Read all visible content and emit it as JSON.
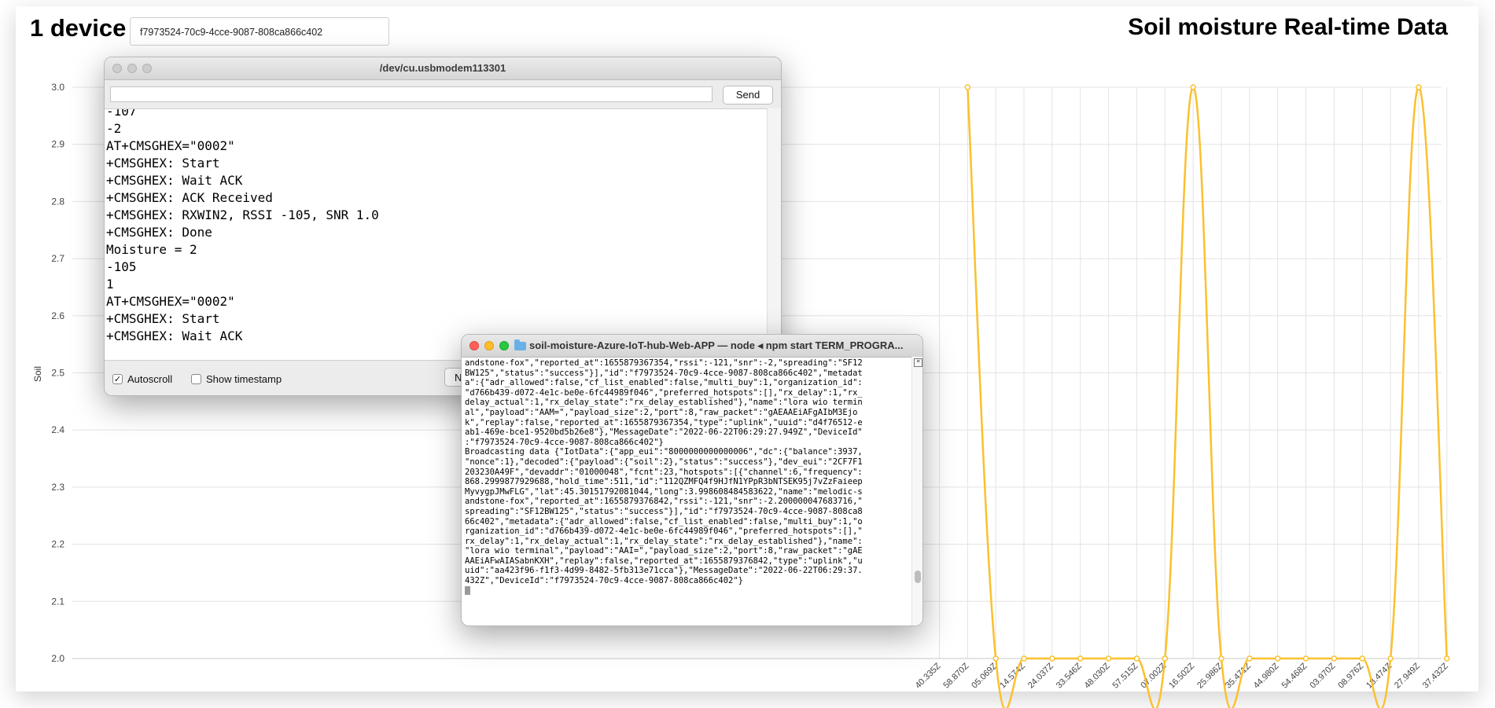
{
  "page": {
    "device_count_label": "1 device",
    "device_select_value": "f7973524-70c9-4cce-9087-808ca866c402",
    "title": "Soil moisture Real-time Data"
  },
  "chart_data": {
    "type": "line",
    "ylabel": "Soil",
    "ylim": [
      2.0,
      3.0
    ],
    "yticks": [
      "3.0",
      "2.9",
      "2.8",
      "2.7",
      "2.6",
      "2.5",
      "2.4",
      "2.3",
      "2.2",
      "2.1",
      "2.0"
    ],
    "grid": true,
    "color": "#fbc02d",
    "x": [
      "40.335Z",
      "58.870Z",
      "05.069Z",
      "14.574Z",
      "24.037Z",
      "33.546Z",
      "48.030Z",
      "57.515Z",
      "07.002Z",
      "16.502Z",
      "25.986Z",
      "35.471Z",
      "44.980Z",
      "54.468Z",
      "03.970Z",
      "08.976Z",
      "18.474Z",
      "27.949Z",
      "37.432Z"
    ],
    "values": [
      null,
      3,
      2,
      2,
      2,
      2,
      2,
      2,
      2,
      3,
      2,
      2,
      2,
      2,
      2,
      2,
      2,
      3,
      2
    ]
  },
  "serial_monitor": {
    "title": "/dev/cu.usbmodem113301",
    "send_label": "Send",
    "send_value": "",
    "lines": [
      "-107",
      "-2",
      "AT+CMSGHEX=\"0002\"",
      "+CMSGHEX: Start",
      "+CMSGHEX: Wait ACK",
      "+CMSGHEX: ACK Received",
      "+CMSGHEX: RXWIN2, RSSI -105, SNR 1.0",
      "+CMSGHEX: Done",
      "Moisture = 2",
      "-105",
      "1",
      "AT+CMSGHEX=\"0002\"",
      "+CMSGHEX: Start",
      "+CMSGHEX: Wait ACK"
    ],
    "autoscroll_label": "Autoscroll",
    "autoscroll_checked": true,
    "timestamp_label": "Show timestamp",
    "timestamp_checked": false,
    "partial_button_label": "Ne"
  },
  "terminal": {
    "title": "soil-moisture-Azure-IoT-hub-Web-APP — node ◂ npm start TERM_PROGRA...",
    "lines": [
      "andstone-fox\",\"reported_at\":1655879367354,\"rssi\":-121,\"snr\":-2,\"spreading\":\"SF12",
      "BW125\",\"status\":\"success\"}],\"id\":\"f7973524-70c9-4cce-9087-808ca866c402\",\"metadat",
      "a\":{\"adr_allowed\":false,\"cf_list_enabled\":false,\"multi_buy\":1,\"organization_id\":",
      "\"d766b439-d072-4e1c-be0e-6fc44989f046\",\"preferred_hotspots\":[],\"rx_delay\":1,\"rx_",
      "delay_actual\":1,\"rx_delay_state\":\"rx_delay_established\"},\"name\":\"lora wio termin",
      "al\",\"payload\":\"AAM=\",\"payload_size\":2,\"port\":8,\"raw_packet\":\"gAEAAEiAFgAIbM3Ejo",
      "k\",\"replay\":false,\"reported_at\":1655879367354,\"type\":\"uplink\",\"uuid\":\"d4f76512-e",
      "ab1-469e-bce1-9520bd5b26e8\"},\"MessageDate\":\"2022-06-22T06:29:27.949Z\",\"DeviceId\"",
      ":\"f7973524-70c9-4cce-9087-808ca866c402\"}",
      "Broadcasting data {\"IotData\":{\"app_eui\":\"8000000000000006\",\"dc\":{\"balance\":3937,",
      "\"nonce\":1},\"decoded\":{\"payload\":{\"soil\":2},\"status\":\"success\"},\"dev_eui\":\"2CF7F1",
      "203230A49F\",\"devaddr\":\"01000048\",\"fcnt\":23,\"hotspots\":[{\"channel\":6,\"frequency\":",
      "868.2999877929688,\"hold_time\":511,\"id\":\"112QZMFQ4f9HJfN1YPpR3bNTSEK95j7vZzFaieep",
      "MyvygpJMwFLG\",\"lat\":45.30151792081044,\"long\":3.998608484583622,\"name\":\"melodic-s",
      "andstone-fox\",\"reported_at\":1655879376842,\"rssi\":-121,\"snr\":-2.200000047683716,\"",
      "spreading\":\"SF12BW125\",\"status\":\"success\"}],\"id\":\"f7973524-70c9-4cce-9087-808ca8",
      "66c402\",\"metadata\":{\"adr_allowed\":false,\"cf_list_enabled\":false,\"multi_buy\":1,\"o",
      "rganization_id\":\"d766b439-d072-4e1c-be0e-6fc44989f046\",\"preferred_hotspots\":[],\"",
      "rx_delay\":1,\"rx_delay_actual\":1,\"rx_delay_state\":\"rx_delay_established\"},\"name\":",
      "\"lora wio terminal\",\"payload\":\"AAI=\",\"payload_size\":2,\"port\":8,\"raw_packet\":\"gAE",
      "AAEiAFwAIASabnKXH\",\"replay\":false,\"reported_at\":1655879376842,\"type\":\"uplink\",\"u",
      "uid\":\"aa423f96-f1f3-4d99-8482-5fb313e71cca\"},\"MessageDate\":\"2022-06-22T06:29:37.",
      "432Z\",\"DeviceId\":\"f7973524-70c9-4cce-9087-808ca866c402\"}"
    ]
  }
}
